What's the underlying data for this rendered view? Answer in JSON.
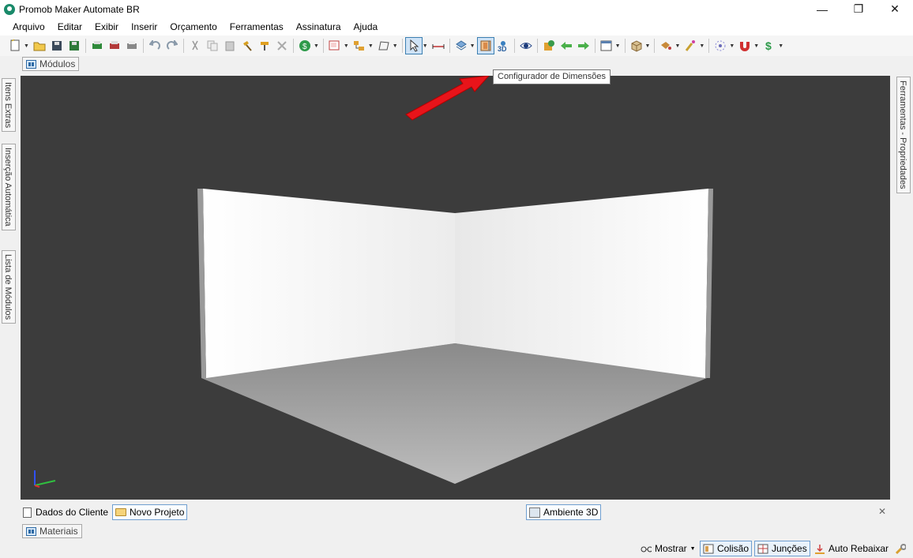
{
  "window": {
    "title": "Promob Maker Automate BR",
    "minimize": "—",
    "restore": "❐",
    "close": "✕"
  },
  "menu": [
    "Arquivo",
    "Editar",
    "Exibir",
    "Inserir",
    "Orçamento",
    "Ferramentas",
    "Assinatura",
    "Ajuda"
  ],
  "toolbar": {
    "tooltip": "Configurador de Dimensões",
    "active_tool": "dimension-configurator",
    "threed_label": "3D"
  },
  "top_tab": {
    "label": "Módulos"
  },
  "left_panels": [
    "Itens Extras",
    "Inserção Automática",
    "Lista de Módulos"
  ],
  "right_panels": [
    "Ferramentas - Propriedades"
  ],
  "viewport": {
    "background": "#3c3c3c",
    "scene": "room-corner-walls-floor"
  },
  "bottom_tabs": {
    "client_data": "Dados do Cliente",
    "new_project": "Novo Projeto",
    "environment_3d": "Ambiente 3D",
    "close": "✕"
  },
  "materials_tab": {
    "label": "Materiais"
  },
  "status": {
    "show": "Mostrar",
    "collision": "Colisão",
    "joints": "Junções",
    "auto_lower": "Auto Rebaixar"
  },
  "colors": {
    "accent": "#3c7fb1",
    "annotation_arrow": "#e8141a",
    "viewport_bg": "#3c3c3c"
  }
}
